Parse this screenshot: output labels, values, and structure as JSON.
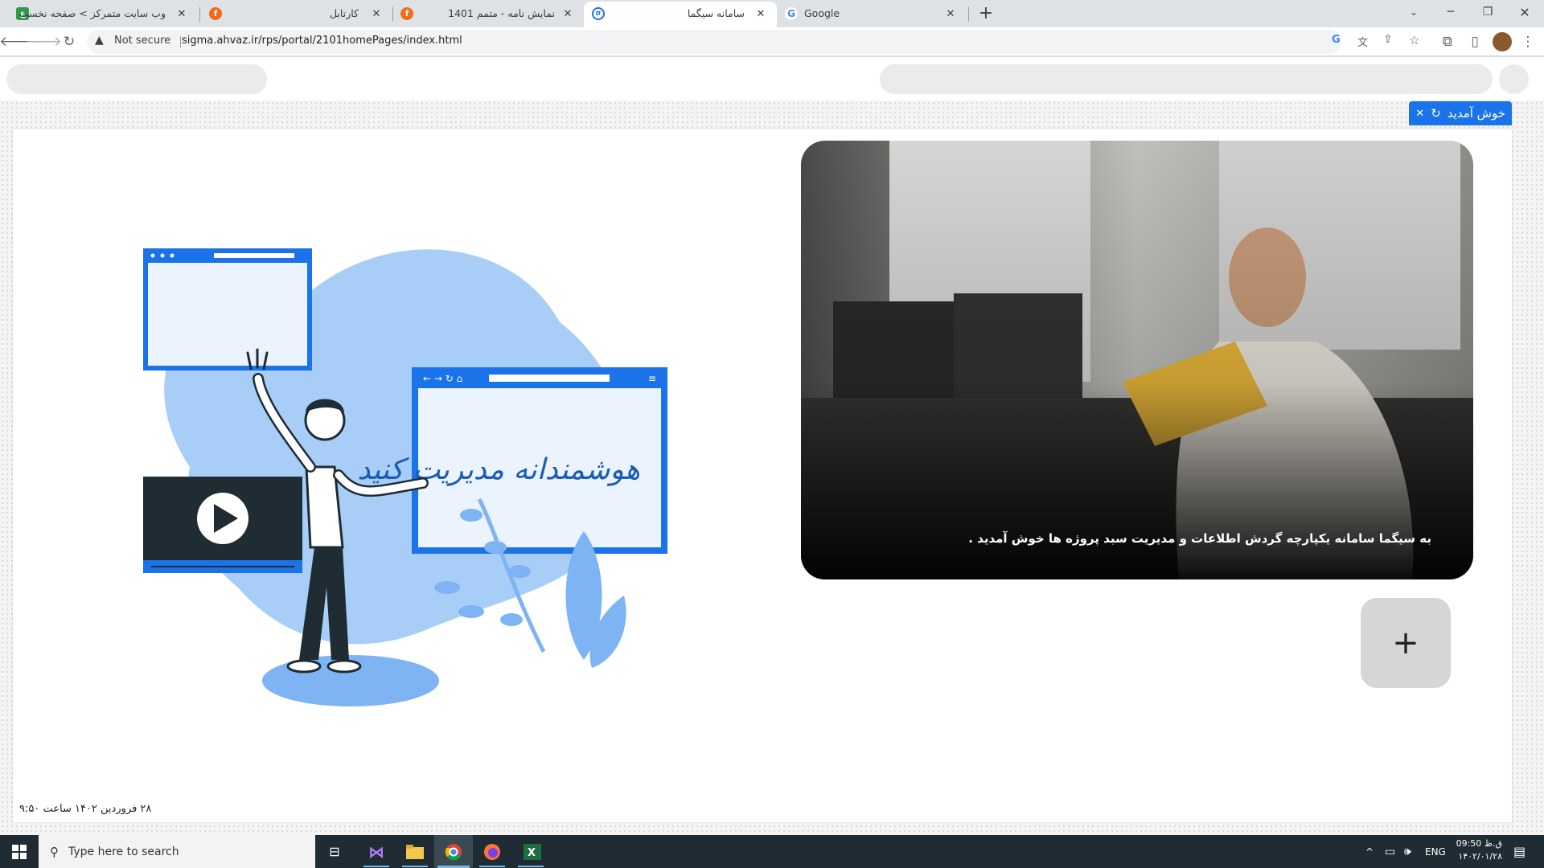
{
  "browser": {
    "tabs": [
      {
        "title": "وب سایت متمرکز > صفحه نخست",
        "favicon": "ahvaz-logo-icon",
        "active": false
      },
      {
        "title": "کارتابل",
        "favicon": "orange-f-icon",
        "active": false
      },
      {
        "title": "نمایش نامه - متمم 1401",
        "favicon": "orange-f-icon",
        "active": false
      },
      {
        "title": "سامانه سیگما",
        "favicon": "sigma-icon",
        "active": true
      },
      {
        "title": "Google",
        "favicon": "google-icon",
        "active": false
      }
    ],
    "security_label": "Not secure",
    "url": "sigma.ahvaz.ir/rps/portal/2101homePages/index.html"
  },
  "page": {
    "welcome_tab_label": "خوش آمدید",
    "illustration_text": "هوشمندانه مدیریت کنید",
    "photo_caption": "به سیگما سامانه یکپارچه گردش اطلاعات و مدیریت سبد پروژه ها خوش آمدید .",
    "footer_datetime": "۲۸ فروردین ۱۴۰۲ ساعت ۹:۵۰"
  },
  "taskbar": {
    "search_placeholder": "Type here to search",
    "language": "ENG",
    "clock_time": "09:50 ق.ظ",
    "clock_date": "۱۴۰۲/۰۱/۲۸"
  },
  "colors": {
    "accent_blue": "#1a73e8",
    "illustration_blue": "#1a73e8",
    "blob_blue": "#a8cdf7",
    "taskbar": "#1f2c33"
  }
}
